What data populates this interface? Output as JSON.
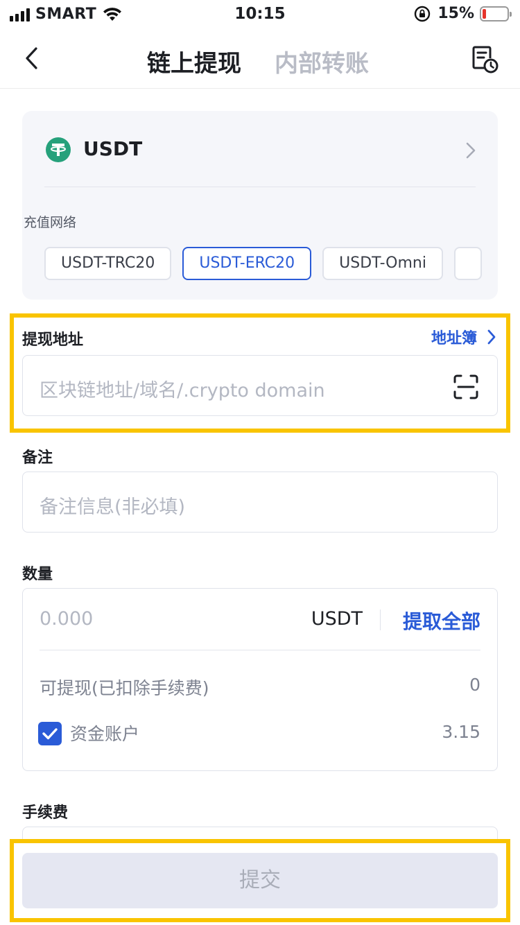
{
  "status_bar": {
    "carrier": "SMART",
    "time": "10:15",
    "battery": "15%",
    "battery_level": 0.15
  },
  "nav": {
    "tab_active": "链上提现",
    "tab_inactive": "内部转账",
    "back_icon": "chevron-left-icon",
    "history_icon": "record-history-icon"
  },
  "coin": {
    "name": "USDT",
    "icon": "tether-icon",
    "icon_color": "#26a17b"
  },
  "network": {
    "label": "充值网络",
    "options": [
      "USDT-TRC20",
      "USDT-ERC20",
      "USDT-Omni"
    ],
    "selected": "USDT-ERC20"
  },
  "address": {
    "label": "提现地址",
    "book_link": "地址簿",
    "placeholder": "区块链地址/域名/.crypto domain",
    "scan_icon": "scan-icon"
  },
  "memo": {
    "label": "备注",
    "placeholder": "备注信息(非必填)"
  },
  "amount": {
    "label": "数量",
    "placeholder": "0.000",
    "unit": "USDT",
    "withdraw_all": "提取全部",
    "available_label": "可提现(已扣除手续费)",
    "available_value": "0",
    "fund_account_label": "资金账户",
    "fund_account_value": "3.15",
    "fund_account_checked": true
  },
  "fee": {
    "label": "手续费"
  },
  "submit": {
    "label": "提交"
  },
  "colors": {
    "accent": "#2a5bd7",
    "highlight": "#f9c400"
  }
}
